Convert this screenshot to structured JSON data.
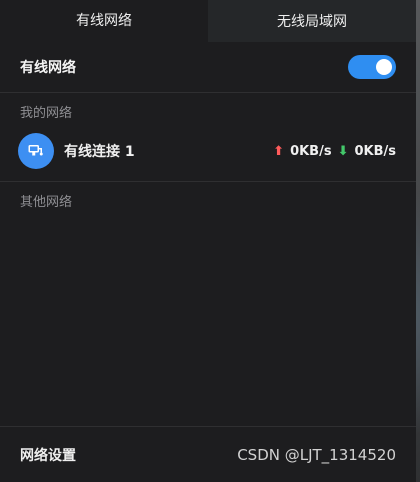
{
  "tabs": {
    "wired": "有线网络",
    "wireless": "无线局域网"
  },
  "wired_section": {
    "label": "有线网络",
    "enabled": true
  },
  "my_networks": {
    "title": "我的网络",
    "connection": {
      "name": "有线连接 1",
      "upload": "0KB/s",
      "download": "0KB/s"
    }
  },
  "other_networks": {
    "title": "其他网络"
  },
  "footer": {
    "settings": "网络设置",
    "watermark": "CSDN @LJT_1314520"
  },
  "colors": {
    "accent": "#2f8ef1",
    "upload_arrow": "#ff5b5b",
    "download_arrow": "#43c86a"
  },
  "icons": {
    "connection": "wired-network-icon",
    "upload": "up-arrow-icon",
    "download": "down-arrow-icon"
  }
}
